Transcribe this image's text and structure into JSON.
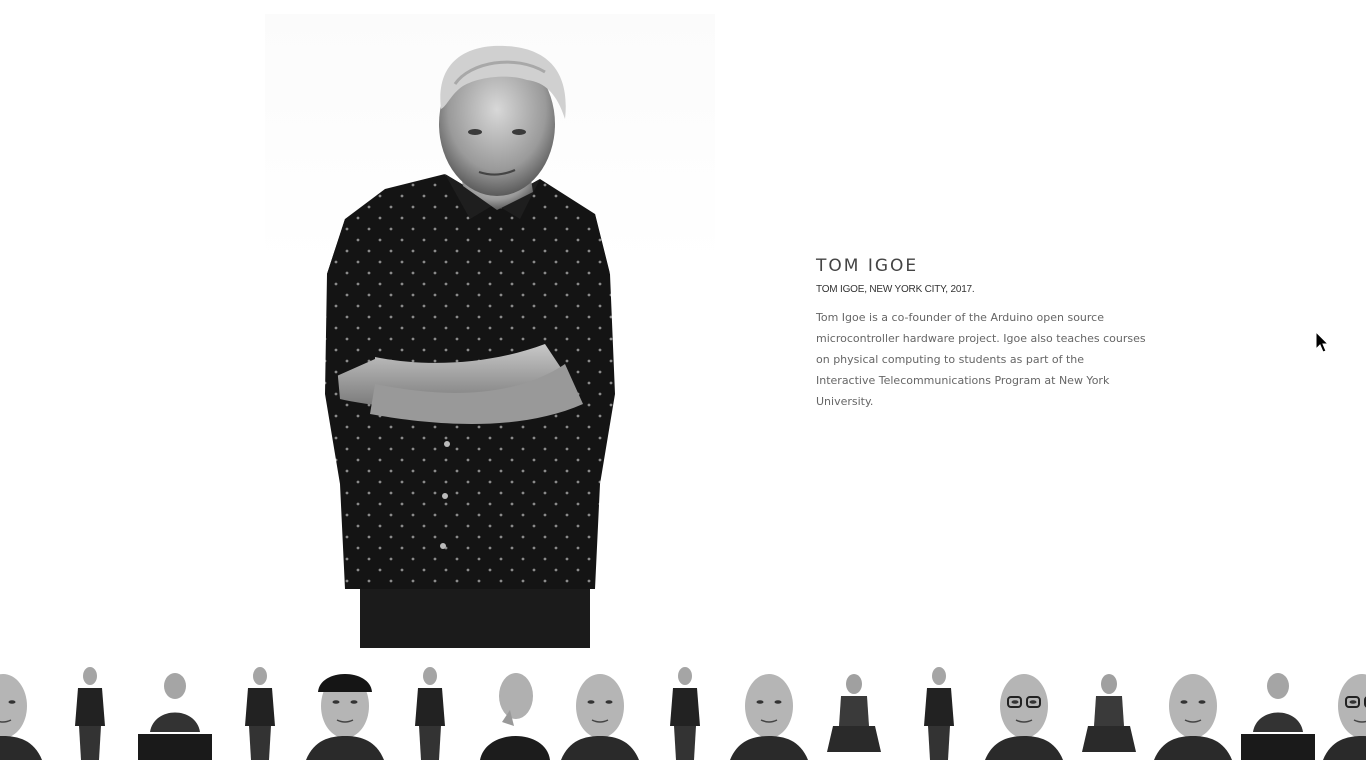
{
  "profile": {
    "name": "TOM IGOE",
    "caption": "TOM IGOE, NEW YORK CITY, 2017.",
    "bio": "Tom Igoe is a co-founder of the Arduino open source microcontroller hardware project. Igoe also teaches courses on physical computing to students as part of the Interactive Telecommunications Program at New York University."
  },
  "thumbnails": [
    {
      "style": "closeup-face"
    },
    {
      "style": "standing-full"
    },
    {
      "style": "leaning-table"
    },
    {
      "style": "standing-full"
    },
    {
      "style": "closeup-cap"
    },
    {
      "style": "standing-full"
    },
    {
      "style": "hand-on-chin"
    },
    {
      "style": "closeup-face"
    },
    {
      "style": "standing-full"
    },
    {
      "style": "closeup-face"
    },
    {
      "style": "sitting"
    },
    {
      "style": "standing-full"
    },
    {
      "style": "closeup-glasses"
    },
    {
      "style": "sitting-chair"
    },
    {
      "style": "closeup-face"
    },
    {
      "style": "seated-table"
    },
    {
      "style": "closeup-glasses"
    }
  ]
}
